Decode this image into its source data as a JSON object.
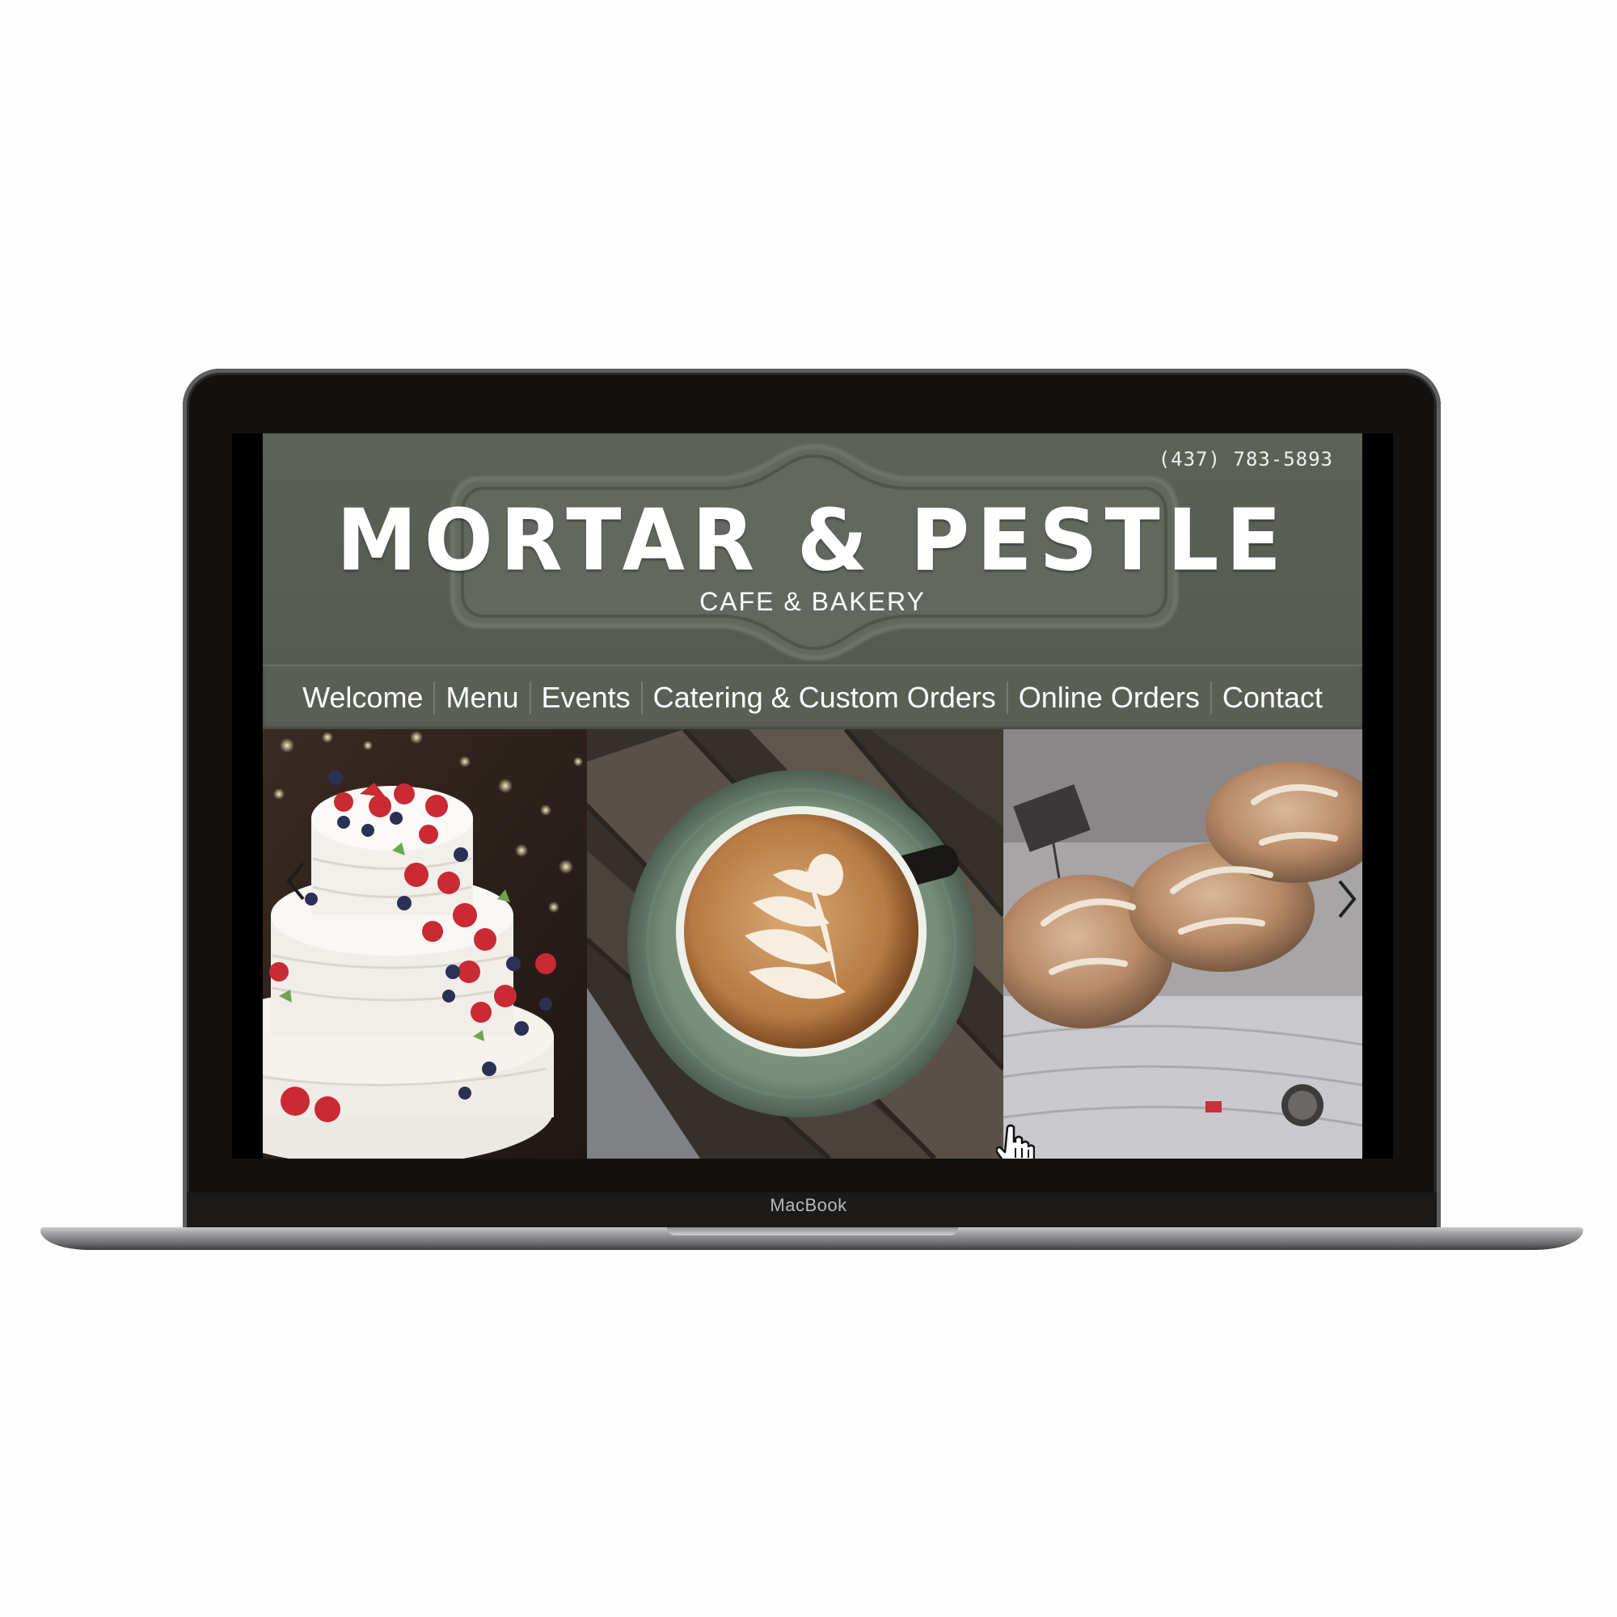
{
  "device": {
    "brand_label": "MacBook"
  },
  "site": {
    "phone": "(437) 783-5893",
    "logo": {
      "title": "MORTAR & PESTLE",
      "subtitle": "CAFE & BAKERY"
    },
    "nav": [
      {
        "label": "Welcome"
      },
      {
        "label": "Menu"
      },
      {
        "label": "Events"
      },
      {
        "label": "Catering & Custom Orders"
      },
      {
        "label": "Online Orders"
      },
      {
        "label": "Contact"
      }
    ],
    "slider": {
      "slides": [
        {
          "subject": "tiered-cake-with-berries"
        },
        {
          "subject": "latte-art-cup"
        },
        {
          "subject": "artisan-bread-loaves"
        }
      ],
      "prev_icon": "chevron-left-icon",
      "next_icon": "chevron-right-icon"
    }
  },
  "colors": {
    "header_bg": "#5d6259",
    "nav_bg": "#5a5f56",
    "text": "#ffffff"
  }
}
